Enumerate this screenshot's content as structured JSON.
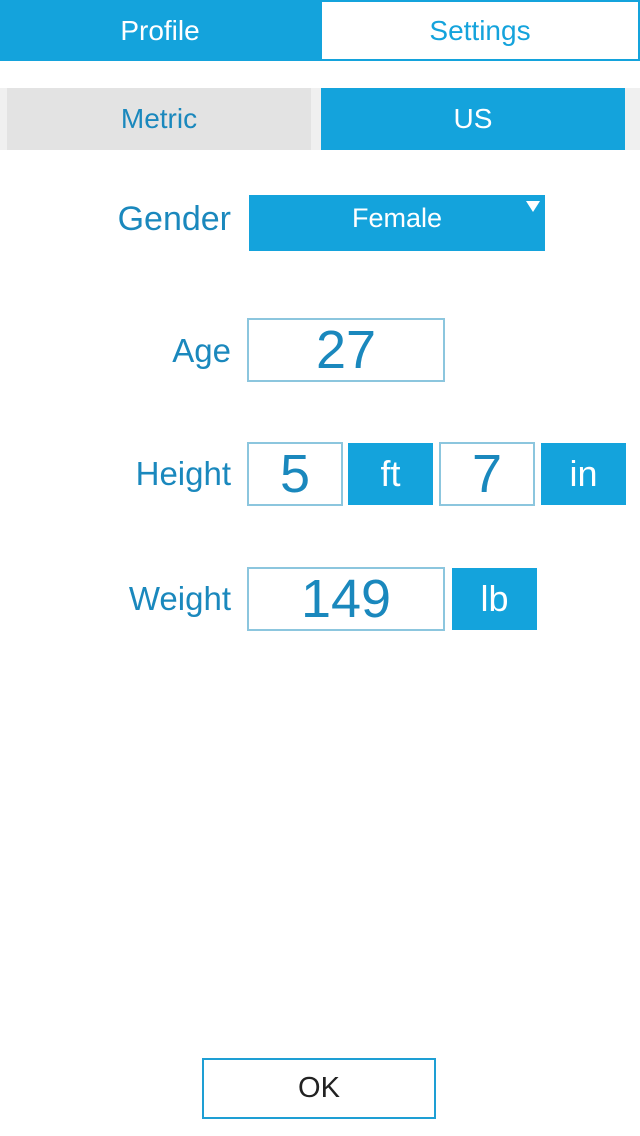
{
  "tabs": [
    {
      "label": "Profile",
      "active": true
    },
    {
      "label": "Settings",
      "active": false
    }
  ],
  "units": {
    "options": [
      "Metric",
      "US"
    ],
    "selected": "US"
  },
  "form": {
    "gender": {
      "label": "Gender",
      "value": "Female"
    },
    "age": {
      "label": "Age",
      "value": "27"
    },
    "height": {
      "label": "Height",
      "feet": "5",
      "feet_unit": "ft",
      "inches": "7",
      "inches_unit": "in"
    },
    "weight": {
      "label": "Weight",
      "value": "149",
      "unit": "lb"
    }
  },
  "ok_label": "OK",
  "colors": {
    "accent": "#14a3dc",
    "label_text": "#1a88bd",
    "segment_off": "#e3e3e3"
  }
}
